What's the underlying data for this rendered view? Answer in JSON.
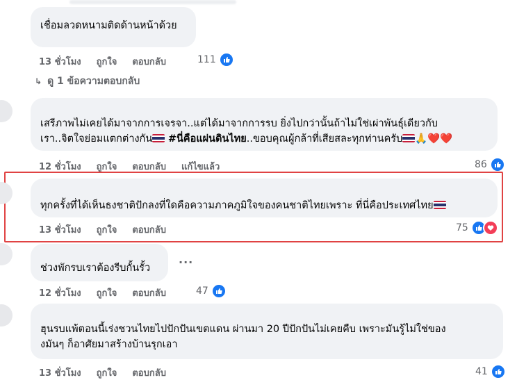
{
  "comments": [
    {
      "text": "เชื่อมลวดหนามติดด้านหน้าด้วย",
      "time": "13 ชั่วโมง",
      "like_label": "ถูกใจ",
      "reply_label": "ตอบกลับ",
      "reaction_count": "111"
    },
    {
      "text_line1": "เสรีภาพไม่เคยได้มาจากการเจรจา..แต่ได้มาจากการรบ ยิ่งไปกว่านั้นถ้าไม่ใช่เผ่าพันธุ์เดียวกับ",
      "text_line2_a": "เรา..จิตใจย่อมแตกต่างกัน",
      "hashtag": "#นี่คือแผ่นดินไทย",
      "text_line2_b": "..ขอบคุณผู้กล้าที่เสียสละทุกท่านครับ",
      "emoji_tail": "🙏❤️❤️",
      "time": "12 ชั่วโมง",
      "like_label": "ถูกใจ",
      "reply_label": "ตอบกลับ",
      "edited_label": "แก้ไขแล้ว",
      "reaction_count": "86"
    },
    {
      "text": "ทุกครั้งที่ได้เห็นธงชาติปักลงที่ใดคือความภาคภูมิใจของคนชาติไทยเพราะ ที่นี่คือประเทศไทย",
      "time": "13 ชั่วโมง",
      "like_label": "ถูกใจ",
      "reply_label": "ตอบกลับ",
      "reaction_count": "75"
    },
    {
      "text": "ช่วงพักรบเราต้องรีบกั้นรั้ว",
      "time": "12 ชั่วโมง",
      "like_label": "ถูกใจ",
      "reply_label": "ตอบกลับ",
      "reaction_count": "47",
      "more_label": "..."
    },
    {
      "text_line1": "ฮุนรบแพ้ตอนนี้เร่งชวนไทยไปปักปันเขตแดน ผ่านมา 20 ปีปักปันไม่เคยคืบ เพราะมันรู้ไม่ใช่ของ",
      "text_line2": "งมันๆ ก็อาศัยมาสร้างบ้านรุกเอา",
      "time": "13 ชั่วโมง",
      "like_label": "ถูกใจ",
      "reply_label": "ตอบกลับ",
      "reaction_count": "41"
    }
  ],
  "view_replies_label": "ดู 1 ข้อความตอบกลับ",
  "icons": {
    "like": "like-icon",
    "love": "love-icon",
    "flag": "thai-flag-icon"
  },
  "colors": {
    "bubble": "#f0f2f5",
    "meta": "#65676b",
    "like_blue": "#1877f2",
    "love_red": "#f33e58",
    "highlight": "#e04343"
  }
}
